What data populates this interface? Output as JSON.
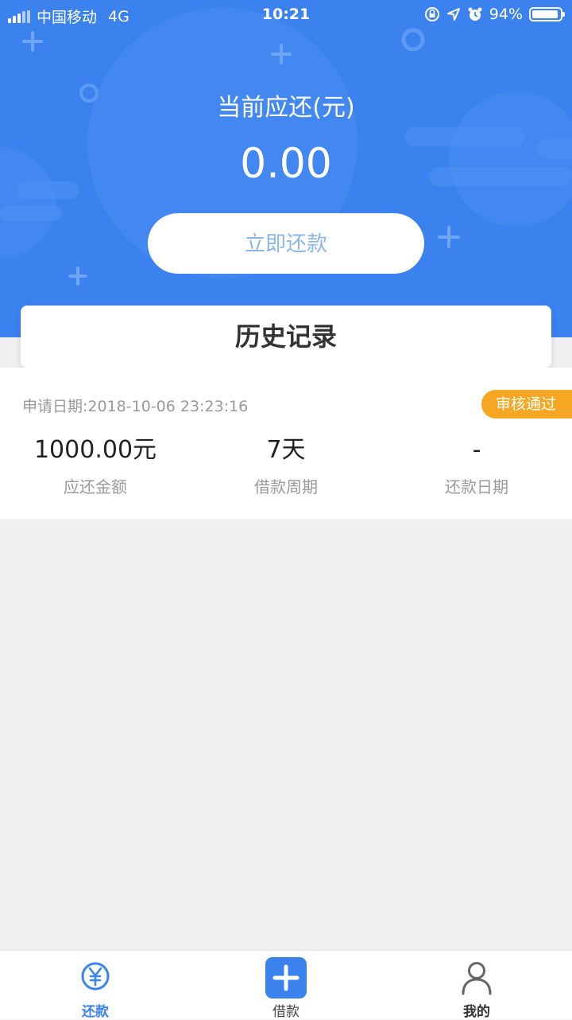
{
  "status_bar": {
    "carrier": "中国移动",
    "network": "4G",
    "time": "10:21",
    "battery": "94%",
    "battery_level": 0.94
  },
  "header": {
    "due_label": "当前应还(元)",
    "due_amount": "0.00",
    "repay_button": "立即还款"
  },
  "history": {
    "title": "历史记录"
  },
  "record": {
    "apply_date": "申请日期:2018-10-06 23:23:16",
    "status": "审核通过",
    "stats": [
      {
        "value": "1000.00元",
        "label": "应还金额"
      },
      {
        "value": "7天",
        "label": "借款周期"
      },
      {
        "value": "-",
        "label": "还款日期"
      }
    ]
  },
  "tabbar": {
    "tabs": [
      {
        "label": "还款",
        "icon": "yen-circle-icon",
        "active": true
      },
      {
        "label": "借款",
        "icon": "plus-square-icon",
        "active": false
      },
      {
        "label": "我的",
        "icon": "user-icon",
        "active": false
      }
    ]
  },
  "colors": {
    "primary": "#3b82ef",
    "badge": "#f5a623",
    "background": "#f0f0f0",
    "button_text": "#8ab4ee"
  }
}
